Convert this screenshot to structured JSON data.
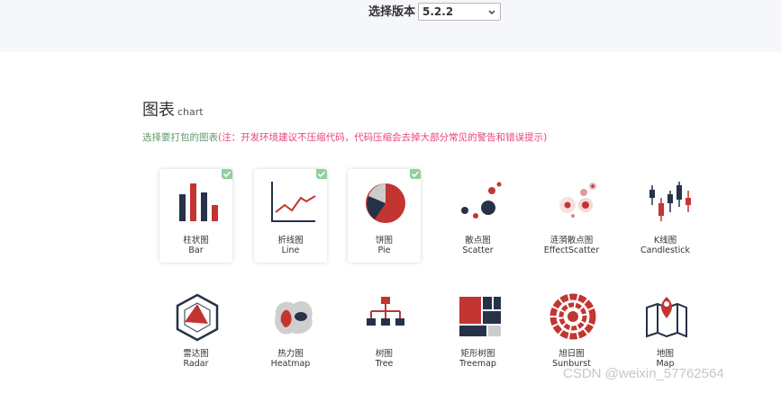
{
  "version": {
    "label": "选择版本",
    "selected": "5.2.2"
  },
  "section": {
    "title": "图表",
    "title_en": "chart",
    "desc": "选择要打包的图表",
    "note": "(注：开发环境建议不压缩代码，代码压缩会去掉大部分常见的警告和错误提示)"
  },
  "charts": [
    {
      "cn": "柱状图",
      "en": "Bar",
      "checked": true
    },
    {
      "cn": "折线图",
      "en": "Line",
      "checked": true
    },
    {
      "cn": "饼图",
      "en": "Pie",
      "checked": true
    },
    {
      "cn": "散点图",
      "en": "Scatter",
      "checked": false
    },
    {
      "cn": "涟漪散点图",
      "en": "EffectScatter",
      "checked": false
    },
    {
      "cn": "K线图",
      "en": "Candlestick",
      "checked": false
    },
    {
      "cn": "雷达图",
      "en": "Radar",
      "checked": false
    },
    {
      "cn": "热力图",
      "en": "Heatmap",
      "checked": false
    },
    {
      "cn": "树图",
      "en": "Tree",
      "checked": false
    },
    {
      "cn": "矩形树图",
      "en": "Treemap",
      "checked": false
    },
    {
      "cn": "旭日图",
      "en": "Sunburst",
      "checked": false
    },
    {
      "cn": "地图",
      "en": "Map",
      "checked": false
    }
  ],
  "icons": [
    "bar-chart-icon",
    "line-chart-icon",
    "pie-chart-icon",
    "scatter-chart-icon",
    "effect-scatter-icon",
    "candlestick-icon",
    "radar-chart-icon",
    "heatmap-icon",
    "tree-chart-icon",
    "treemap-icon",
    "sunburst-icon",
    "map-pin-icon"
  ],
  "colors": {
    "navy": "#253247",
    "red": "#c23531",
    "check": "#8fd19e",
    "desc_green": "#5f9a6a",
    "note_pink": "#e8457a"
  },
  "watermark": "CSDN @weixin_57762564"
}
